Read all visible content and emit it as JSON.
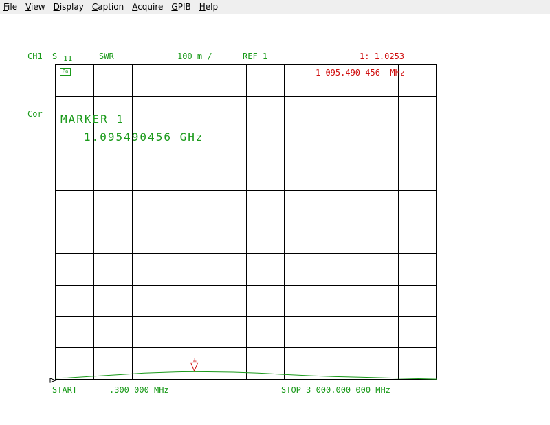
{
  "menu": {
    "items": [
      {
        "label": "File",
        "mnemonic": "F",
        "rest": "ile"
      },
      {
        "label": "View",
        "mnemonic": "V",
        "rest": "iew"
      },
      {
        "label": "Display",
        "mnemonic": "D",
        "rest": "isplay"
      },
      {
        "label": "Caption",
        "mnemonic": "C",
        "rest": "aption"
      },
      {
        "label": "Acquire",
        "mnemonic": "A",
        "rest": "cquire"
      },
      {
        "label": "GPIB",
        "mnemonic": "G",
        "rest": "PIB"
      },
      {
        "label": "Help",
        "mnemonic": "H",
        "rest": "elp"
      }
    ]
  },
  "header": {
    "channel": "CH1",
    "param": "S",
    "param_sub": "11",
    "format": "SWR",
    "scale": "100 m /",
    "ref": "REF 1",
    "marker_readout": "1: 1.0253",
    "marker_freq": "1 095.490 456  MHz"
  },
  "side": {
    "cor": "Cor",
    "cor_icon": "Pa"
  },
  "marker_box": {
    "title": "MARKER 1",
    "value": "1.095490456 GHz"
  },
  "marker_symbol": {
    "label": "1"
  },
  "footer": {
    "start": "START",
    "start_value": ".300 000 MHz",
    "stop": "STOP 3 000.000 000 MHz"
  },
  "colors": {
    "trace": "#1a9a1a",
    "marker": "#d01010",
    "grid": "#000000"
  },
  "trace": {
    "x_ghz": [
      0.0003,
      0.1,
      0.3,
      0.5,
      0.7,
      0.9,
      1.0,
      1.0955,
      1.2,
      1.4,
      1.6,
      1.8,
      2.0,
      2.2,
      2.4,
      2.6,
      2.8,
      3.0
    ],
    "swr": [
      1.005,
      1.006,
      1.011,
      1.016,
      1.021,
      1.024,
      1.025,
      1.0253,
      1.025,
      1.024,
      1.021,
      1.017,
      1.013,
      1.01,
      1.008,
      1.006,
      1.004,
      1.002
    ],
    "xlim_ghz": [
      0.0003,
      3.0
    ],
    "ylim_swr": [
      1.0,
      2.0
    ],
    "marker_x_ghz": 1.095490456,
    "marker_y_swr": 1.0253
  }
}
